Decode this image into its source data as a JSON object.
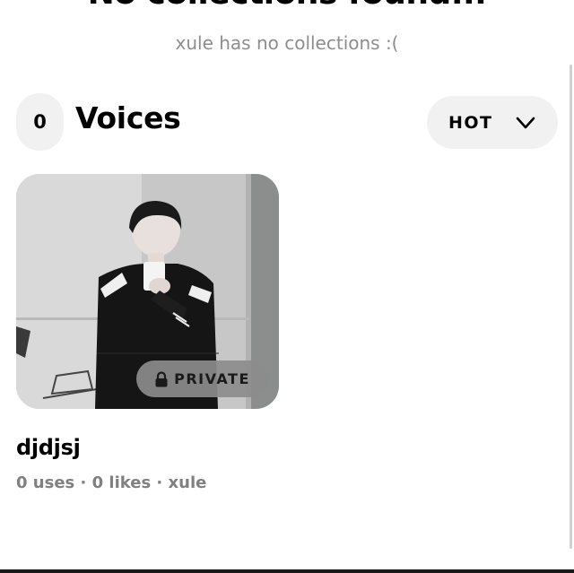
{
  "empty_state": {
    "title": "No collections found...",
    "subtitle": "xule has no collections :("
  },
  "voices_section": {
    "count": "0",
    "title": "Voices",
    "sort_label": "HOT",
    "sort_icon": "chevron-down-icon"
  },
  "voices": [
    {
      "name": "djdjsj",
      "visibility_label": "PRIVATE",
      "visibility_icon": "lock-icon",
      "meta": "0 uses · 0 likes · xule"
    }
  ]
}
